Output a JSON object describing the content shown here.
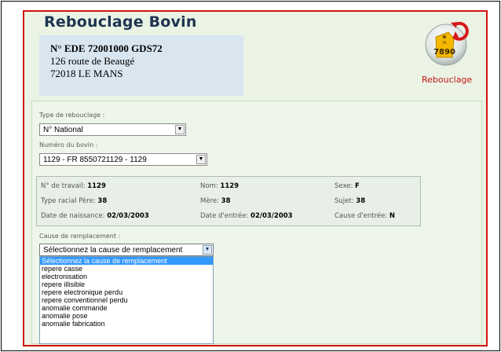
{
  "header": {
    "title": "Rebouclage Bovin",
    "logo_label": "Rebouclage",
    "logo_tag_number": "7890"
  },
  "address": {
    "ede_line": "N° EDE 72001000  GDS72",
    "street": "126 route de Beaugé",
    "city": "72018 LE MANS"
  },
  "form": {
    "type_label": "Type de rebouclage :",
    "type_value": "N° National",
    "bovin_label": "Numéro du bovin :",
    "bovin_value": "1129 - FR 8550721129 - 1129",
    "cause_label": "Cause de remplacement :",
    "cause_value": "Sélectionnez la cause de remplacement"
  },
  "info": {
    "travail_label": "N° de travail:",
    "travail_value": "1129",
    "nom_label": "Nom:",
    "nom_value": "1129",
    "sexe_label": "Sexe:",
    "sexe_value": "F",
    "type_racial_label": "Type racial Père:",
    "type_racial_value": "38",
    "mere_label": "Mère:",
    "mere_value": "38",
    "sujet_label": "Sujet:",
    "sujet_value": "38",
    "naissance_label": "Date de naissance:",
    "naissance_value": "02/03/2003",
    "entree_label": "Date d'entrée:",
    "entree_value": "02/03/2003",
    "cause_entree_label": "Cause d'entrée:",
    "cause_entree_value": "N"
  },
  "dropdown": {
    "options": [
      "Sélectionnez la cause de remplacement",
      "repere casse",
      "electronisation",
      "repere illisible",
      "repere electronique perdu",
      "repere conventionnel perdu",
      "anomalie commande",
      "anomalie pose",
      "anomalie fabrication"
    ],
    "highlighted_index": 0
  },
  "colors": {
    "frame_border": "#d2140c",
    "panel_background": "#eaf3e4",
    "address_background": "#d9e6f0",
    "highlight": "#3399ff",
    "title": "#1e3550"
  }
}
